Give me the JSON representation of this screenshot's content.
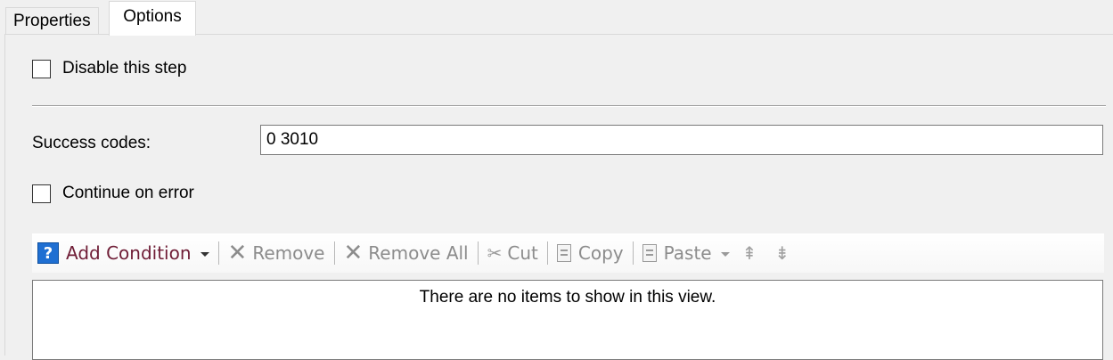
{
  "tabs": {
    "properties": "Properties",
    "options": "Options"
  },
  "options": {
    "disable_step_label": "Disable this step",
    "success_codes_label": "Success codes:",
    "success_codes_value": "0 3010",
    "continue_on_error_label": "Continue on error"
  },
  "toolbar": {
    "add_condition": "Add Condition",
    "remove": "Remove",
    "remove_all": "Remove All",
    "cut": "Cut",
    "copy": "Copy",
    "paste": "Paste"
  },
  "list": {
    "empty_text": "There are no items to show in this view."
  },
  "colors": {
    "add_condition_text": "#6f1d36",
    "disabled_text": "#8c8c8c",
    "help_icon": "#1f6fd2"
  },
  "icons": {
    "help": "help-icon",
    "remove": "x-icon",
    "remove_all": "x-icon",
    "cut": "scissors-icon",
    "copy": "copy-icon",
    "paste": "clipboard-icon",
    "move_up": "move-up-icon",
    "move_down": "move-down-icon"
  }
}
